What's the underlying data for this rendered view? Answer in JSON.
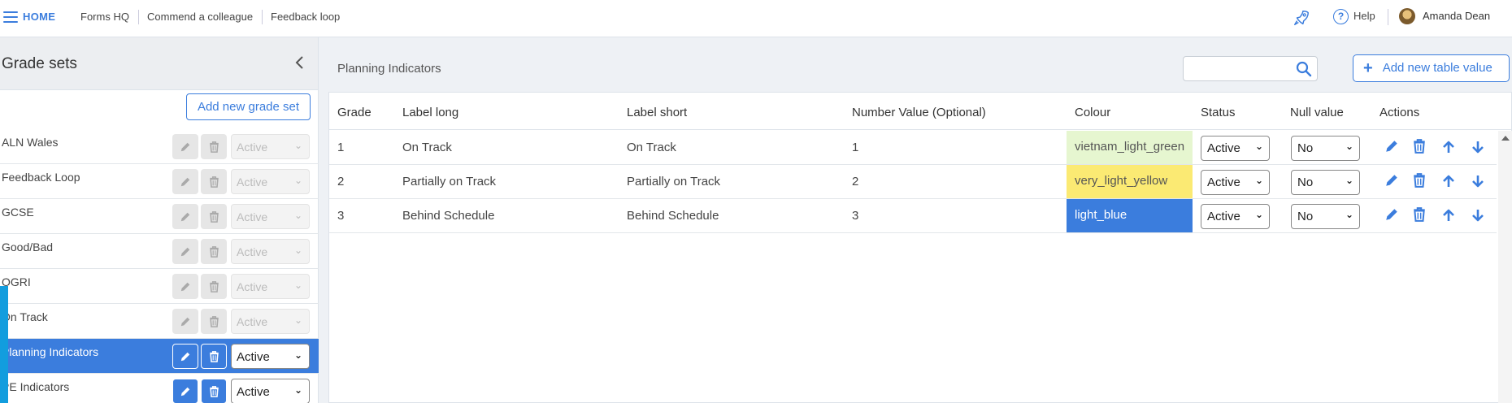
{
  "nav": {
    "home": "HOME",
    "links": [
      "Forms HQ",
      "Commend a colleague",
      "Feedback loop"
    ],
    "help": "Help",
    "user_name": "Amanda Dean"
  },
  "sidebar": {
    "title": "Grade sets",
    "add_button": "Add new grade set",
    "items": [
      {
        "name": "ALN Wales",
        "status": "Active",
        "selected": false,
        "enabled": false
      },
      {
        "name": "Feedback Loop",
        "status": "Active",
        "selected": false,
        "enabled": false
      },
      {
        "name": "GCSE",
        "status": "Active",
        "selected": false,
        "enabled": false
      },
      {
        "name": "Good/Bad",
        "status": "Active",
        "selected": false,
        "enabled": false
      },
      {
        "name": "OGRI",
        "status": "Active",
        "selected": false,
        "enabled": false
      },
      {
        "name": "On Track",
        "status": "Active",
        "selected": false,
        "enabled": false
      },
      {
        "name": "Planning Indicators",
        "status": "Active",
        "selected": true,
        "enabled": true
      },
      {
        "name": "PE Indicators",
        "status": "Active",
        "selected": false,
        "enabled": true
      }
    ]
  },
  "main": {
    "title": "Planning Indicators",
    "search_placeholder": "",
    "add_button": "Add new table value",
    "columns": [
      "Grade",
      "Label long",
      "Label short",
      "Number Value (Optional)",
      "Colour",
      "Status",
      "Null value",
      "Actions"
    ],
    "rows": [
      {
        "grade": "1",
        "label_long": "On Track",
        "label_short": "On Track",
        "number": "1",
        "colour": "vietnam_light_green",
        "colour_hex": "#e6f6d0",
        "colour_text": "#555555",
        "status": "Active",
        "null_value": "No"
      },
      {
        "grade": "2",
        "label_long": "Partially on Track",
        "label_short": "Partially on Track",
        "number": "2",
        "colour": "very_light_yellow",
        "colour_hex": "#fbea73",
        "colour_text": "#555555",
        "status": "Active",
        "null_value": "No"
      },
      {
        "grade": "3",
        "label_long": "Behind Schedule",
        "label_short": "Behind Schedule",
        "number": "3",
        "colour": "light_blue",
        "colour_hex": "#3b7ddd",
        "colour_text": "#ffffff",
        "status": "Active",
        "null_value": "No"
      }
    ]
  },
  "colors": {
    "accent": "#3b7ddd",
    "marker": "#129dde"
  }
}
